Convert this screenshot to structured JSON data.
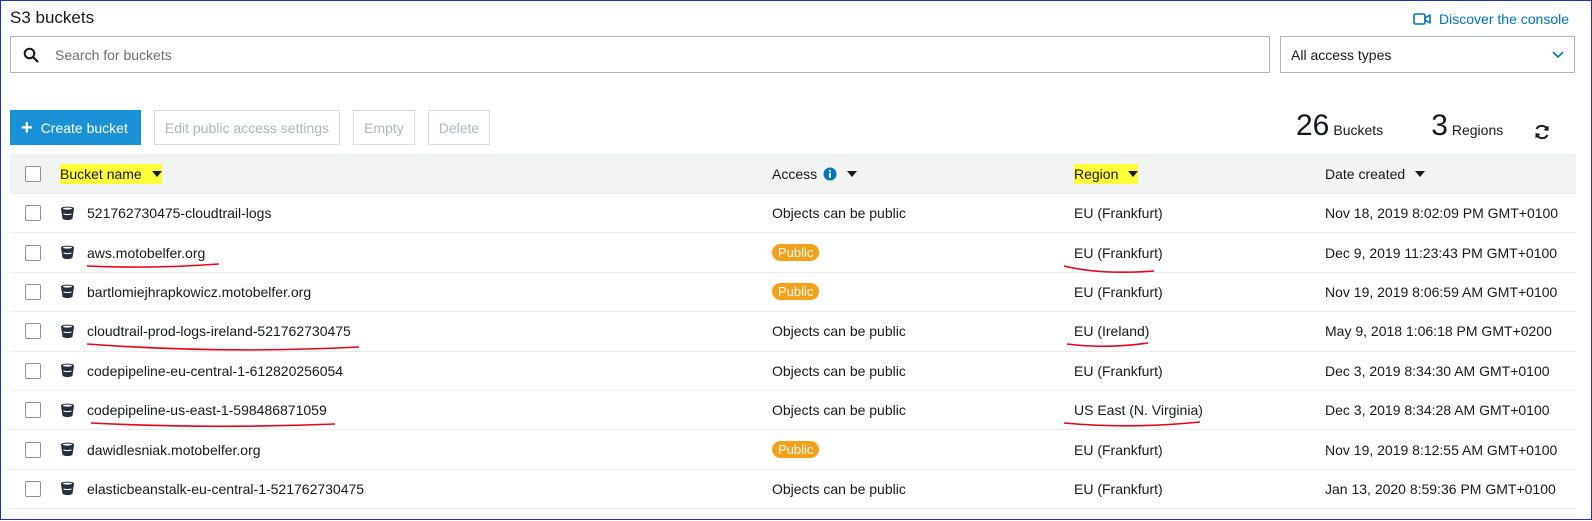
{
  "header": {
    "title": "S3 buckets",
    "discover_label": "Discover the console",
    "discover_icon": "video-camera-icon"
  },
  "search": {
    "placeholder": "Search for buckets",
    "value": "",
    "icon": "search-icon"
  },
  "access_filter": {
    "selected": "All access types",
    "icon": "chevron-down-icon"
  },
  "toolbar": {
    "create_label": "Create bucket",
    "edit_public_label": "Edit public access settings",
    "empty_label": "Empty",
    "delete_label": "Delete"
  },
  "stats": {
    "buckets_count": "26",
    "buckets_label": "Buckets",
    "regions_count": "3",
    "regions_label": "Regions"
  },
  "table": {
    "columns": {
      "name": "Bucket name",
      "access": "Access",
      "region": "Region",
      "date": "Date created"
    },
    "rows": [
      {
        "name": "521762730475-cloudtrail-logs",
        "access": "Objects can be public",
        "public": false,
        "region": "EU (Frankfurt)",
        "date": "Nov 18, 2019 8:02:09 PM GMT+0100"
      },
      {
        "name": "aws.motobelfer.org",
        "access": "Public",
        "public": true,
        "region": "EU (Frankfurt)",
        "date": "Dec 9, 2019 11:23:43 PM GMT+0100"
      },
      {
        "name": "bartlomiejhrapkowicz.motobelfer.org",
        "access": "Public",
        "public": true,
        "region": "EU (Frankfurt)",
        "date": "Nov 19, 2019 8:06:59 AM GMT+0100"
      },
      {
        "name": "cloudtrail-prod-logs-ireland-521762730475",
        "access": "Objects can be public",
        "public": false,
        "region": "EU (Ireland)",
        "date": "May 9, 2018 1:06:18 PM GMT+0200"
      },
      {
        "name": "codepipeline-eu-central-1-612820256054",
        "access": "Objects can be public",
        "public": false,
        "region": "EU (Frankfurt)",
        "date": "Dec 3, 2019 8:34:30 AM GMT+0100"
      },
      {
        "name": "codepipeline-us-east-1-598486871059",
        "access": "Objects can be public",
        "public": false,
        "region": "US East (N. Virginia)",
        "date": "Dec 3, 2019 8:34:28 AM GMT+0100"
      },
      {
        "name": "dawidlesniak.motobelfer.org",
        "access": "Public",
        "public": true,
        "region": "EU (Frankfurt)",
        "date": "Nov 19, 2019 8:12:55 AM GMT+0100"
      },
      {
        "name": "elasticbeanstalk-eu-central-1-521762730475",
        "access": "Objects can be public",
        "public": false,
        "region": "EU (Frankfurt)",
        "date": "Jan 13, 2020 8:59:36 PM GMT+0100"
      }
    ]
  },
  "colors": {
    "link_blue": "#0073bb",
    "primary_button": "#1a91d7",
    "public_badge": "#f5a01a",
    "highlight_yellow": "#ffff3a",
    "annotation_red": "#e8001c"
  }
}
